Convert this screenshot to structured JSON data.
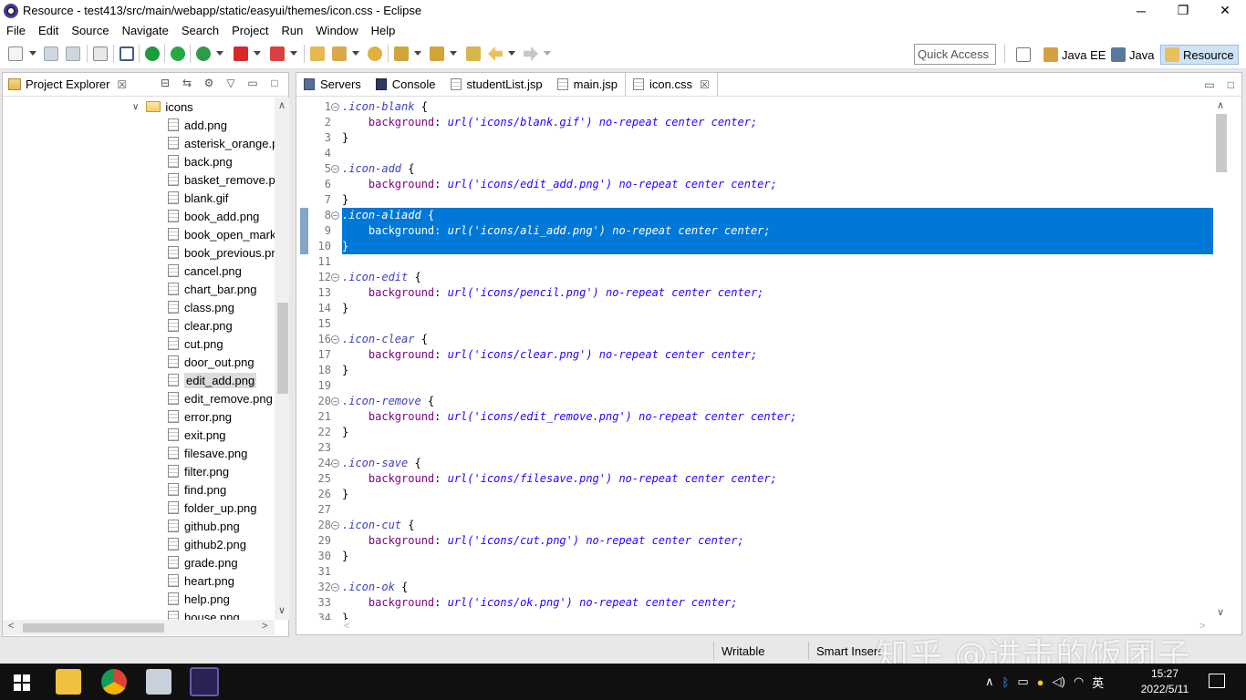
{
  "window": {
    "title": "Resource - test413/src/main/webapp/static/easyui/themes/icon.css - Eclipse",
    "minimize": "─",
    "maximize": "❐",
    "close": "✕"
  },
  "menu": [
    "File",
    "Edit",
    "Source",
    "Navigate",
    "Search",
    "Project",
    "Run",
    "Window",
    "Help"
  ],
  "toolbar": {
    "quick_access_placeholder": "Quick Access",
    "perspectives": [
      {
        "label": "Java EE"
      },
      {
        "label": "Java"
      },
      {
        "label": "Resource",
        "active": true
      }
    ]
  },
  "explorer": {
    "tab_label": "Project Explorer",
    "close_glyph": "☒",
    "folder": "icons",
    "selected": "edit_add.png",
    "files": [
      "add.png",
      "asterisk_orange.png",
      "back.png",
      "basket_remove.png",
      "blank.gif",
      "book_add.png",
      "book_open_mark.png",
      "book_previous.png",
      "cancel.png",
      "chart_bar.png",
      "class.png",
      "clear.png",
      "cut.png",
      "door_out.png",
      "edit_add.png",
      "edit_remove.png",
      "error.png",
      "exit.png",
      "filesave.png",
      "filter.png",
      "find.png",
      "folder_up.png",
      "github.png",
      "github2.png",
      "grade.png",
      "heart.png",
      "help.png",
      "house.png"
    ]
  },
  "editor": {
    "tabs": [
      {
        "label": "Servers",
        "icon": "servers-icon"
      },
      {
        "label": "Console",
        "icon": "console-icon"
      },
      {
        "label": "studentList.jsp",
        "icon": "file-icon"
      },
      {
        "label": "main.jsp",
        "icon": "file-icon"
      },
      {
        "label": "icon.css",
        "icon": "file-icon",
        "active": true
      }
    ],
    "selected_lines": [
      8,
      9,
      10
    ],
    "lines": [
      {
        "n": "1",
        "fold": true,
        "sel": ".icon-blank",
        "brace": " {"
      },
      {
        "n": "2",
        "prop": "background",
        "url": "url('icons/blank.gif')",
        "rest": " no-repeat center center;"
      },
      {
        "n": "3",
        "text": "}"
      },
      {
        "n": "4",
        "text": ""
      },
      {
        "n": "5",
        "fold": true,
        "sel": ".icon-add",
        "brace": " {"
      },
      {
        "n": "6",
        "prop": "background",
        "url": "url('icons/edit_add.png')",
        "rest": " no-repeat center center;"
      },
      {
        "n": "7",
        "text": "}"
      },
      {
        "n": "8",
        "fold": true,
        "sel": ".icon-aliadd",
        "brace": " {"
      },
      {
        "n": "9",
        "prop": "background",
        "url": "url('icons/ali_add.png')",
        "rest": " no-repeat center center;"
      },
      {
        "n": "10",
        "text": "}"
      },
      {
        "n": "11",
        "text": ""
      },
      {
        "n": "12",
        "fold": true,
        "sel": ".icon-edit",
        "brace": " {"
      },
      {
        "n": "13",
        "prop": "background",
        "url": "url('icons/pencil.png')",
        "rest": " no-repeat center center;"
      },
      {
        "n": "14",
        "text": "}"
      },
      {
        "n": "15",
        "text": ""
      },
      {
        "n": "16",
        "fold": true,
        "sel": ".icon-clear",
        "brace": " {"
      },
      {
        "n": "17",
        "prop": "background",
        "url": "url('icons/clear.png')",
        "rest": " no-repeat center center;"
      },
      {
        "n": "18",
        "text": "}"
      },
      {
        "n": "19",
        "text": ""
      },
      {
        "n": "20",
        "fold": true,
        "sel": ".icon-remove",
        "brace": " {"
      },
      {
        "n": "21",
        "prop": "background",
        "url": "url('icons/edit_remove.png')",
        "rest": " no-repeat center center;"
      },
      {
        "n": "22",
        "text": "}"
      },
      {
        "n": "23",
        "text": ""
      },
      {
        "n": "24",
        "fold": true,
        "sel": ".icon-save",
        "brace": " {"
      },
      {
        "n": "25",
        "prop": "background",
        "url": "url('icons/filesave.png')",
        "rest": " no-repeat center center;"
      },
      {
        "n": "26",
        "text": "}"
      },
      {
        "n": "27",
        "text": ""
      },
      {
        "n": "28",
        "fold": true,
        "sel": ".icon-cut",
        "brace": " {"
      },
      {
        "n": "29",
        "prop": "background",
        "url": "url('icons/cut.png')",
        "rest": " no-repeat center center;"
      },
      {
        "n": "30",
        "text": "}"
      },
      {
        "n": "31",
        "text": ""
      },
      {
        "n": "32",
        "fold": true,
        "sel": ".icon-ok",
        "brace": " {"
      },
      {
        "n": "33",
        "prop": "background",
        "url": "url('icons/ok.png')",
        "rest": " no-repeat center center;"
      },
      {
        "n": "34",
        "text": "}"
      }
    ]
  },
  "status": {
    "writable": "Writable",
    "insert_mode": "Smart Insert"
  },
  "watermark": "知乎 @进击的饭团子",
  "taskbar": {
    "ime": "英",
    "time": "15:27",
    "date": "2022/5/11"
  },
  "colors": {
    "selection": "#0078d7",
    "selector_text": "#3f3fbf",
    "property_text": "#7f007f",
    "value_text": "#2a00ff"
  }
}
